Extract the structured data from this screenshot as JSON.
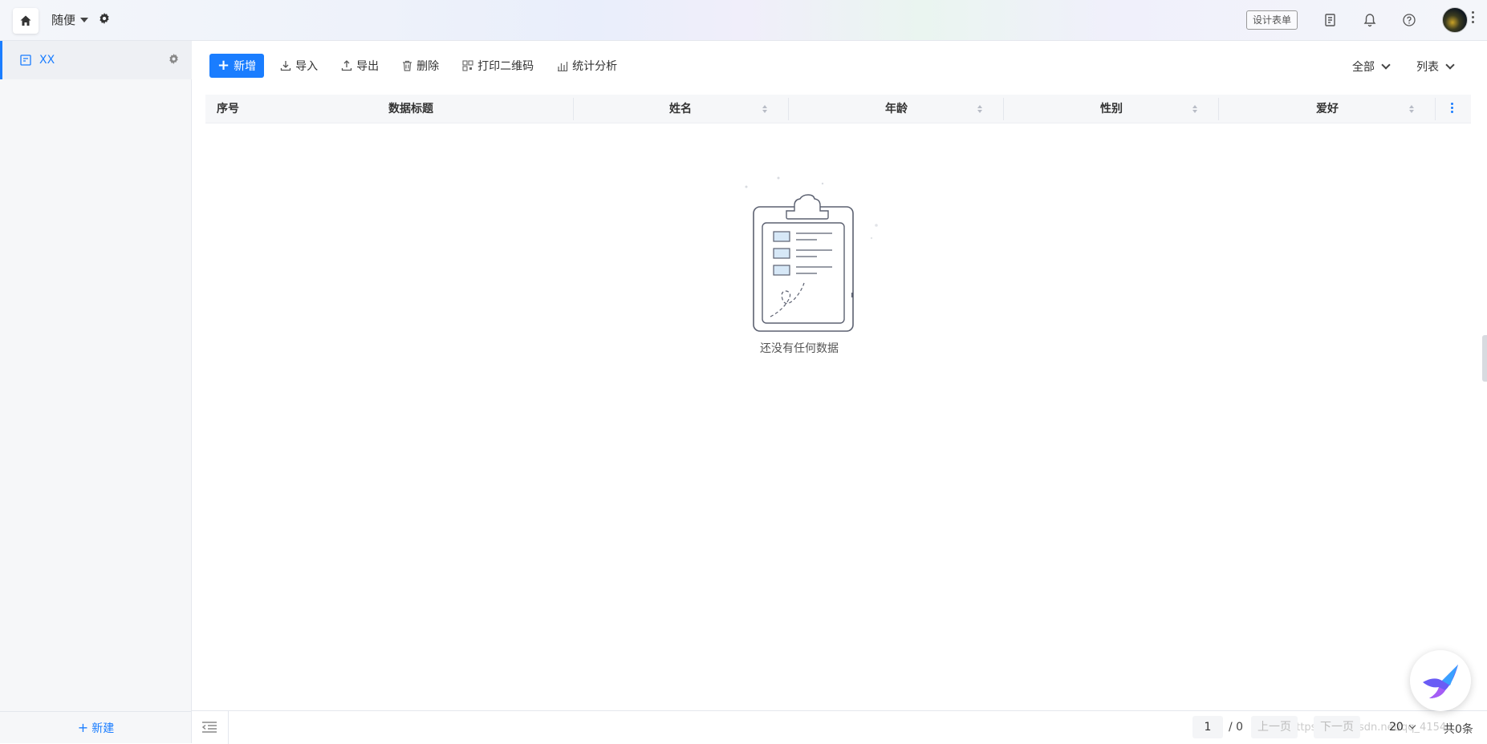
{
  "topbar": {
    "app_name": "随便",
    "design_form_label": "设计表单"
  },
  "sidebar": {
    "items": [
      {
        "label": "XX"
      }
    ],
    "new_label": "新建"
  },
  "toolbar": {
    "add_label": "新增",
    "import_label": "导入",
    "export_label": "导出",
    "delete_label": "删除",
    "print_qr_label": "打印二维码",
    "stats_label": "统计分析",
    "filter_label": "全部",
    "view_label": "列表"
  },
  "table": {
    "columns": [
      "序号",
      "数据标题",
      "姓名",
      "年龄",
      "性别",
      "爱好"
    ],
    "rows": []
  },
  "empty_state": {
    "text": "还没有任何数据"
  },
  "pagination": {
    "current_page": "1",
    "total_pages": "/ 0",
    "prev_label": "上一页",
    "next_label": "下一页",
    "page_size": "20",
    "total_label": "共0条"
  },
  "watermark": "https://blog.csdn.net/qq_41544",
  "colors": {
    "accent": "#1a7dff",
    "sidebar_bg": "#f6f7f9",
    "header_bg": "#f6f7f9"
  }
}
